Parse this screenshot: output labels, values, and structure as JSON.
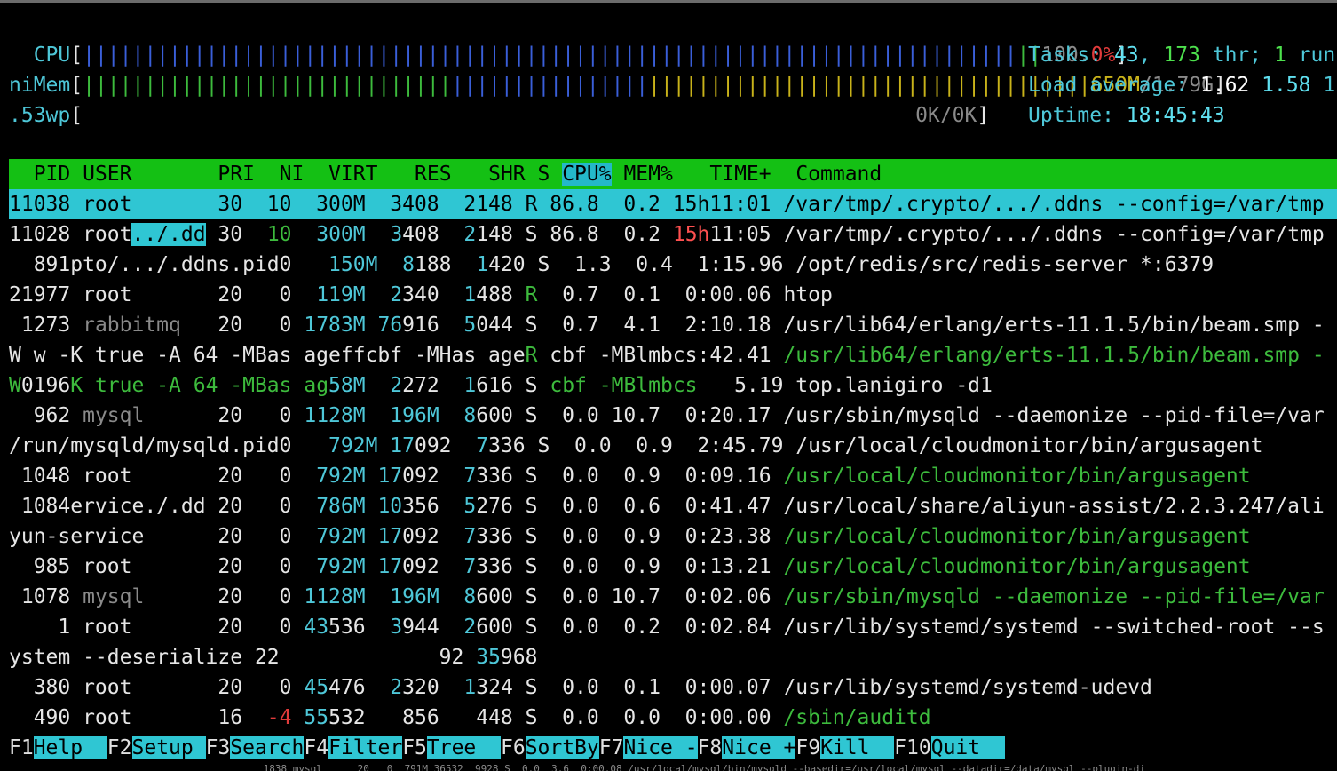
{
  "meters": {
    "cpu_label": "CPU",
    "cpu_open": "[",
    "cpu_bar": "||||||||||||||||||||||||||||||||||||||||||||||||||||||||||||||||||||||||||||",
    "cpu_tail": "||",
    "cpu_value": "100.",
    "cpu_value_pct": "0%",
    "cpu_close": "]",
    "mem_label": "niMem",
    "mem_open": "[",
    "mem_bar_green": "||||||||||||||||||||||||||||||",
    "mem_bar_blue": "||||||||||||||||",
    "mem_bar_yellow": "||||||||||||||||||||||||||||||||||||",
    "mem_used": "650M",
    "mem_total": "/1.79G",
    "mem_close": "]",
    "swp_label": ".53wp",
    "swp_open": "[",
    "swp_value": "0K/0K",
    "swp_close": "]"
  },
  "summary": {
    "tasks_label": "Tasks: ",
    "tasks_count": "43",
    "tasks_sep": ", ",
    "threads_count": "173",
    "threads_label": " thr; ",
    "running_count": "1",
    "running_label": " run",
    "load_label": "Load average: ",
    "load1": "1.62",
    "load5": "1.58",
    "load15": "1",
    "uptime_label": "Uptime: ",
    "uptime_value": "18:45:43"
  },
  "columns": {
    "pid": "  PID",
    "user": " USER     ",
    "pri": "  PRI",
    "ni": "  NI",
    "virt": "  VIRT",
    "res": "   RES",
    "shr": "   SHR",
    "s": " S ",
    "cpu": "CPU%",
    "mem": " MEM%",
    "time": "   TIME+ ",
    " command_label": "",
    "command": " Command"
  },
  "selected_row": "11038 root       30  10  300M  3408  2148 R 86.8  0.2 15h11:01 /var/tmp/.crypto/.../.ddns --config=/var/tmp",
  "rows": [
    [
      [
        "11028 root",
        "w"
      ],
      [
        "../.dd",
        "bgc"
      ],
      [
        " 30  ",
        "w"
      ],
      [
        "10",
        "green"
      ],
      [
        "  300M  ",
        "c"
      ],
      [
        "3",
        "c"
      ],
      [
        "408  ",
        "w"
      ],
      [
        "2",
        "c"
      ],
      [
        "148 S 86.8  0.2 ",
        "w"
      ],
      [
        "15h",
        "bred"
      ],
      [
        "11:05 /var/tmp/.crypto/.../.ddns --config=/var/tmp",
        "w"
      ]
    ],
    [
      [
        "  891pto/.../.ddns.pid0  ",
        "w"
      ],
      [
        " 150M  ",
        "c"
      ],
      [
        "8",
        "c"
      ],
      [
        "188  ",
        "w"
      ],
      [
        "1",
        "c"
      ],
      [
        "420 S  1.3  0.4  1:15.96 /opt/redis/src/redis-server *:6379",
        "w"
      ]
    ],
    [
      [
        "21977 root       20   0  ",
        "w"
      ],
      [
        "119M  ",
        "c"
      ],
      [
        "2",
        "c"
      ],
      [
        "340  ",
        "w"
      ],
      [
        "1",
        "c"
      ],
      [
        "488 ",
        "w"
      ],
      [
        "R",
        "green"
      ],
      [
        "  0.7  0.1  0:00.06 htop",
        "w"
      ]
    ],
    [
      [
        " 1273 ",
        "w"
      ],
      [
        "rabbitmq",
        "grey"
      ],
      [
        "   20   0 ",
        "w"
      ],
      [
        "1783M ",
        "c"
      ],
      [
        "76",
        "c"
      ],
      [
        "916  ",
        "w"
      ],
      [
        "5",
        "c"
      ],
      [
        "044 S  0.7  4.1  2:10.18 /usr/lib64/erlang/erts-11.1.5/bin/beam.smp -",
        "w"
      ]
    ],
    [
      [
        "W w -K true -A 64 -MBas ageffcbf -MHas age",
        "w"
      ],
      [
        "R",
        "green"
      ],
      [
        " cbf -MBlmbcs:42.41 ",
        "w"
      ],
      [
        "/usr/lib64/erlang/erts-11.1.5/bin/beam.smp -",
        "green"
      ]
    ],
    [
      [
        "W",
        "green"
      ],
      [
        "0196",
        "w"
      ],
      [
        "K true -A 64 -MBas ag",
        "green"
      ],
      [
        "58M  ",
        "c"
      ],
      [
        "2",
        "c"
      ],
      [
        "272  ",
        "w"
      ],
      [
        "1",
        "c"
      ],
      [
        "616 S ",
        "w"
      ],
      [
        "cbf -MBlmbcs",
        "green"
      ],
      [
        "   5.19 top.lanigiro -d1",
        "w"
      ]
    ],
    [
      [
        "  962 ",
        "w"
      ],
      [
        "mysql",
        "grey"
      ],
      [
        "      20   0 ",
        "w"
      ],
      [
        "1128M  ",
        "c"
      ],
      [
        "196M  ",
        "c"
      ],
      [
        "8",
        "c"
      ],
      [
        "600 S  0.0 10.7  0:20.17 /usr/sbin/mysqld --daemonize --pid-file=/var",
        "w"
      ]
    ],
    [
      [
        "/run/mysqld/mysqld.pid0  ",
        "w"
      ],
      [
        " 792M ",
        "c"
      ],
      [
        "17",
        "c"
      ],
      [
        "092  ",
        "w"
      ],
      [
        "7",
        "c"
      ],
      [
        "336 S  0.0  0.9  2:45.79 /usr/local/cloudmonitor/bin/argusagent",
        "w"
      ]
    ],
    [
      [
        " 1048 root       20   0  ",
        "w"
      ],
      [
        "792M ",
        "c"
      ],
      [
        "17",
        "c"
      ],
      [
        "092  ",
        "w"
      ],
      [
        "7",
        "c"
      ],
      [
        "336 S  0.0  0.9  0:09.16 ",
        "w"
      ],
      [
        "/usr/local/cloudmonitor/bin/argusagent",
        "green"
      ]
    ],
    [
      [
        " 1084ervice./.dd 20   0  ",
        "w"
      ],
      [
        "786M ",
        "c"
      ],
      [
        "10",
        "c"
      ],
      [
        "356  ",
        "w"
      ],
      [
        "5",
        "c"
      ],
      [
        "276 S  0.0  0.6  0:41.47 /usr/local/share/aliyun-assist/2.2.3.247/ali",
        "w"
      ]
    ],
    [
      [
        "yun-service      20   0  ",
        "w"
      ],
      [
        "792M ",
        "c"
      ],
      [
        "17",
        "c"
      ],
      [
        "092  ",
        "w"
      ],
      [
        "7",
        "c"
      ],
      [
        "336 S  0.0  0.9  0:23.38 ",
        "w"
      ],
      [
        "/usr/local/cloudmonitor/bin/argusagent",
        "green"
      ]
    ],
    [
      [
        "  985 root       20   0  ",
        "w"
      ],
      [
        "792M ",
        "c"
      ],
      [
        "17",
        "c"
      ],
      [
        "092  ",
        "w"
      ],
      [
        "7",
        "c"
      ],
      [
        "336 S  0.0  0.9  0:13.21 ",
        "w"
      ],
      [
        "/usr/local/cloudmonitor/bin/argusagent",
        "green"
      ]
    ],
    [
      [
        " 1078 ",
        "w"
      ],
      [
        "mysql",
        "grey"
      ],
      [
        "      20   0 ",
        "w"
      ],
      [
        "1128M  ",
        "c"
      ],
      [
        "196M  ",
        "c"
      ],
      [
        "8",
        "c"
      ],
      [
        "600 S  0.0 10.7  0:02.06 ",
        "w"
      ],
      [
        "/usr/sbin/mysqld --daemonize --pid-file=/var",
        "green"
      ]
    ],
    [
      [
        "    1 root       20   0 ",
        "w"
      ],
      [
        "43",
        "c"
      ],
      [
        "536  ",
        "w"
      ],
      [
        "3",
        "c"
      ],
      [
        "944  ",
        "w"
      ],
      [
        "2",
        "c"
      ],
      [
        "600 S  0.0  0.2  0:02.84 /usr/lib/systemd/systemd --switched-root --s",
        "w"
      ]
    ],
    [
      [
        "ystem --deserialize 22             92 ",
        "w"
      ],
      [
        "35",
        "c"
      ],
      [
        "968",
        "w"
      ]
    ],
    [
      [
        "  380 root       20   0 ",
        "w"
      ],
      [
        "45",
        "c"
      ],
      [
        "476  ",
        "w"
      ],
      [
        "2",
        "c"
      ],
      [
        "320  ",
        "w"
      ],
      [
        "1",
        "c"
      ],
      [
        "324 S  0.0  0.1  0:00.07 /usr/lib/systemd/systemd-udevd",
        "w"
      ]
    ],
    [
      [
        "  490 root       16  ",
        "w"
      ],
      [
        "-4",
        "red"
      ],
      [
        " ",
        "w"
      ],
      [
        "55",
        "c"
      ],
      [
        "532   856   448 S  0.0  0.0  0:00.00 ",
        "w"
      ],
      [
        "/sbin/auditd",
        "green"
      ]
    ]
  ],
  "function_keys": [
    {
      "key": "F1",
      "label": "Help  "
    },
    {
      "key": "F2",
      "label": "Setup "
    },
    {
      "key": "F3",
      "label": "Search"
    },
    {
      "key": "F4",
      "label": "Filter"
    },
    {
      "key": "F5",
      "label": "Tree  "
    },
    {
      "key": "F6",
      "label": "SortBy"
    },
    {
      "key": "F7",
      "label": "Nice -"
    },
    {
      "key": "F8",
      "label": "Nice +"
    },
    {
      "key": "F9",
      "label": "Kill  "
    },
    {
      "key": "F10",
      "label": "Quit  "
    }
  ],
  "overflow_line": " 1838 mysql      20   0  791M 36532  9928 S  0.0  3.6  0:00.08 /usr/local/mysql/bin/mysqld --basedir=/usr/local/mysql --datadir=/data/mysql --plugin-di"
}
